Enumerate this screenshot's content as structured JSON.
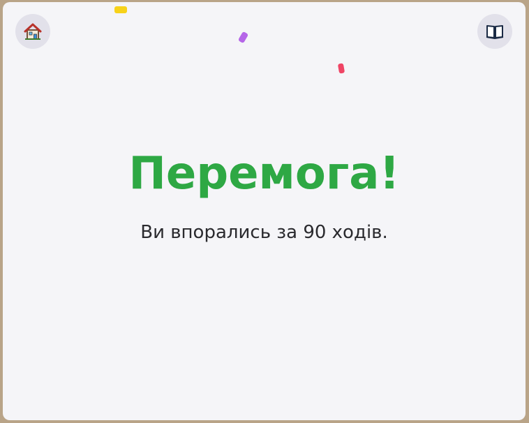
{
  "header": {
    "home_button_icon": "home-icon",
    "rules_button_icon": "open-book-icon"
  },
  "result": {
    "title": "Перемога!",
    "message": "Ви впорались за 90 ходів.",
    "moves": 90
  },
  "colors": {
    "title": "#2ea844",
    "panel_background": "#f5f5f8",
    "frame": "#b9a488",
    "icon_button_background": "#e2e1ea",
    "confetti": [
      "#f7d21a",
      "#b566e8",
      "#ef4565"
    ]
  }
}
